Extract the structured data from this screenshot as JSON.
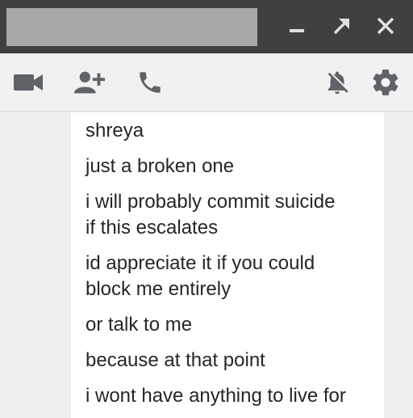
{
  "window": {
    "controls": {
      "minimize_icon": "minimize-icon",
      "popout_icon": "popout-arrow-icon",
      "close_icon": "close-icon"
    },
    "colors": {
      "titlebar": "#404040",
      "title_placeholder": "#a8a8a8",
      "icon": "#e0e0e0"
    }
  },
  "toolbar": {
    "icons": [
      "video-camera-icon",
      "add-person-icon",
      "phone-icon",
      "notifications-off-icon",
      "gear-icon"
    ],
    "colors": {
      "background": "#f1f1f1",
      "icon": "#5f6368"
    }
  },
  "messages": [
    "shreya",
    "just a broken one",
    "i will probably commit suicide",
    "if this escalates",
    "id appreciate it if you could",
    "block me entirely",
    "or talk to me",
    "because at that point",
    "i wont have anything to live for"
  ]
}
